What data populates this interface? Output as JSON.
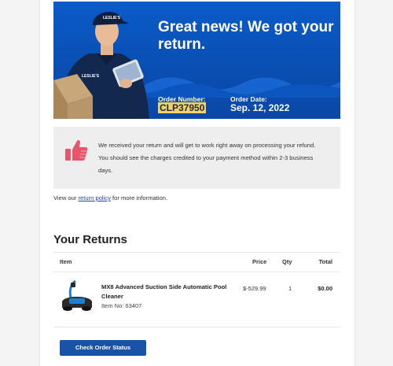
{
  "hero": {
    "headline": "Great news! We got your return.",
    "order_number_label": "Order Number:",
    "order_number": "CLP37950",
    "order_date_label": "Order Date:",
    "order_date": "Sep. 12, 2022",
    "logo_text": "LESLIE'S",
    "background_color": "#0a4fb3",
    "highlight_color": "#f3d265"
  },
  "info": {
    "icon": "thumbs-up-icon",
    "icon_color": "#e8566c",
    "message": "We received your return and will get to work right away on processing your refund. You should see the charges credited to your payment method within 2-3 business days."
  },
  "policy": {
    "prefix": "View our ",
    "link": "return policy",
    "suffix": " for more information."
  },
  "returns": {
    "title": "Your Returns",
    "columns": {
      "item": "Item",
      "price": "Price",
      "qty": "Qty",
      "total": "Total"
    },
    "items": [
      {
        "name": "MX8 Advanced Suction Side Automatic Pool Cleaner",
        "item_no": "Item No: 63407",
        "price": "$-529.99",
        "qty": "1",
        "total": "$0.00",
        "image": "pool-cleaner-icon"
      }
    ]
  },
  "cta": {
    "label": "Check Order Status",
    "color": "#1953a8"
  }
}
